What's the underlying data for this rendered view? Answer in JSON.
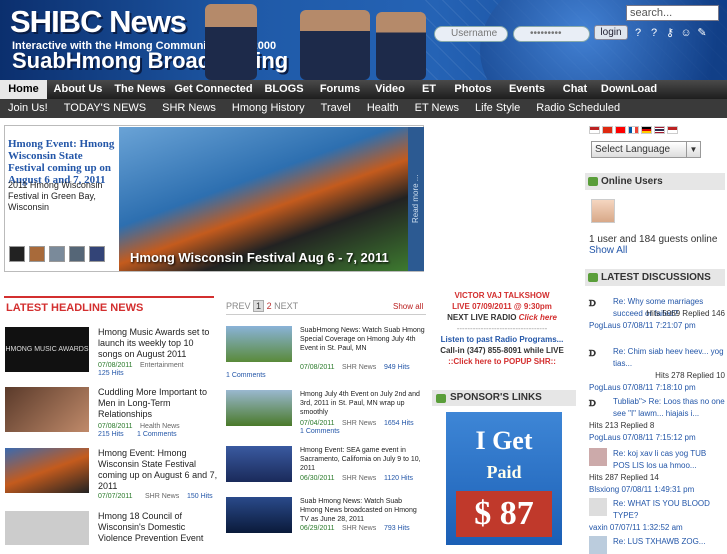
{
  "header": {
    "title": "SHIBC News",
    "subtitle": "Interactive with the Hmong Community Since 2000",
    "brand": "SuabHmong Broadcasting",
    "search_placeholder": "search...",
    "username_placeholder": "Username",
    "password_placeholder": "•••••••••",
    "login_label": "login"
  },
  "nav_primary": [
    "Home",
    "About Us",
    "The News",
    "Get Connected",
    "BLOGS",
    "Forums",
    "Video",
    "ET",
    "Photos",
    "Events",
    "Chat",
    "DownLoad"
  ],
  "nav_secondary": [
    "Join Us!",
    "TODAY'S NEWS",
    "SHR News",
    "Hmong History",
    "Travel",
    "Health",
    "ET News",
    "Life Style",
    "Radio Scheduled"
  ],
  "featured": {
    "title": "Hmong Event: Hmong Wisconsin State Festival coming up on August 6 and 7, 2011",
    "desc": "2011 Hmong Wisconsin Festival in Green Bay, Wisconsin",
    "caption": "Hmong Wisconsin Festival Aug 6 - 7, 2011",
    "read_more": "Read more ..."
  },
  "latest_heading": "LATEST HEADLINE NEWS",
  "latest": [
    {
      "title": "Hmong Music Awards set to launch its weekly top 10 songs on August 2011",
      "date": "07/08/2011",
      "cat": "Entertainment",
      "hits": "125 Hits",
      "comments": "",
      "img_label": "HMONG MUSIC AWARDS"
    },
    {
      "title": "Cuddling More Important to Men in Long-Term Relationships",
      "date": "07/08/2011",
      "cat": "Health News",
      "hits": "215 Hits",
      "comments": "1 Comments",
      "img_label": ""
    },
    {
      "title": "Hmong Event: Hmong Wisconsin State Festival coming up on August 6 and 7, 2011",
      "date": "07/07/2011",
      "cat": "SHR News",
      "hits": "150 Hits",
      "comments": "",
      "img_label": ""
    },
    {
      "title": "Hmong 18 Council of Wisconsin's Domestic Violence Prevention Event",
      "date": "",
      "cat": "",
      "hits": "",
      "comments": "",
      "img_label": ""
    }
  ],
  "pager": {
    "prev": "PREV",
    "pages": [
      "1",
      "2"
    ],
    "next": "NEXT",
    "show_all": "Show all"
  },
  "mid_news": [
    {
      "title": "SuabHmong News: Watch Suab Hmong Special Coverage on Hmong July 4th Event in St. Paul, MN",
      "date": "07/08/2011",
      "cat": "SHR News",
      "hits": "949 Hits",
      "comments": "1 Comments"
    },
    {
      "title": "Hmong July 4th Event on July 2nd and 3rd, 2011 in St. Paul, MN wrap up smoothly",
      "date": "07/04/2011",
      "cat": "SHR News",
      "hits": "1654 Hits",
      "comments": "1 Comments"
    },
    {
      "title": "Hmong Event: SEA game event in Sacramento, California on July 9 to 10, 2011",
      "date": "06/30/2011",
      "cat": "SHR News",
      "hits": "1120 Hits",
      "comments": ""
    },
    {
      "title": "Suab Hmong News: Watch Suab Hmong News broadcasted on Hmong TV as June 28, 2011",
      "date": "06/29/2011",
      "cat": "SHR News",
      "hits": "793 Hits",
      "comments": ""
    }
  ],
  "talkshow": {
    "line1": "VICTOR VAJ TALKSHOW",
    "line2": "LIVE 07/09/2011 @ 9:30pm",
    "line3": "NEXT LIVE RADIO",
    "click": "Click here",
    "sep": "----------------------------------",
    "line4": "Listen to past Radio Programs...",
    "line5": "Call-in (347) 855-8091 while LIVE",
    "line6": "::Click here to POPUP SHR::"
  },
  "sponsor": {
    "heading": "SPONSOR'S LINKS",
    "ad1": "I Get",
    "ad2": "Paid",
    "ad3": "$ 87"
  },
  "sidebar": {
    "language": "Select Language",
    "online_heading": "Online Users",
    "online_text": "1 user and 184 guests online",
    "show_all": "Show All",
    "discussion_heading": "LATEST DISCUSSIONS"
  },
  "discussions": [
    {
      "title": "Re: Why some marriages succeed or failed?",
      "meta": "Hits 5069 Replied 146",
      "user": "PogLaus 07/08/11 7:21:07 pm"
    },
    {
      "title": "Re: Chim siab heev heev... yog tias...",
      "meta": "Hits 278 Replied 10",
      "user": "PogLaus 07/08/11 7:18:10 pm"
    },
    {
      "title": "Tubliab\"> Re: Loos thas no one see \"I\" lawm... hiajais i...",
      "meta": "Hits 213 Replied 8",
      "user": "PogLaus 07/08/11 7:15:12 pm"
    },
    {
      "title": "Re: koj xav li cas yog TUB POS LIS los ua hmoo...",
      "meta": "Hits 287 Replied 14",
      "user": "Blsxiong 07/08/11 1:49:31 pm"
    },
    {
      "title": "Re: WHAT IS YOU BLOOD TYPE?",
      "meta": "Hits 1634 Replied 38",
      "user": "vaxin 07/07/11 1:32:52 am"
    },
    {
      "title": "Re: LUS TXHAWB ZOG...",
      "meta": "",
      "user": ""
    }
  ]
}
